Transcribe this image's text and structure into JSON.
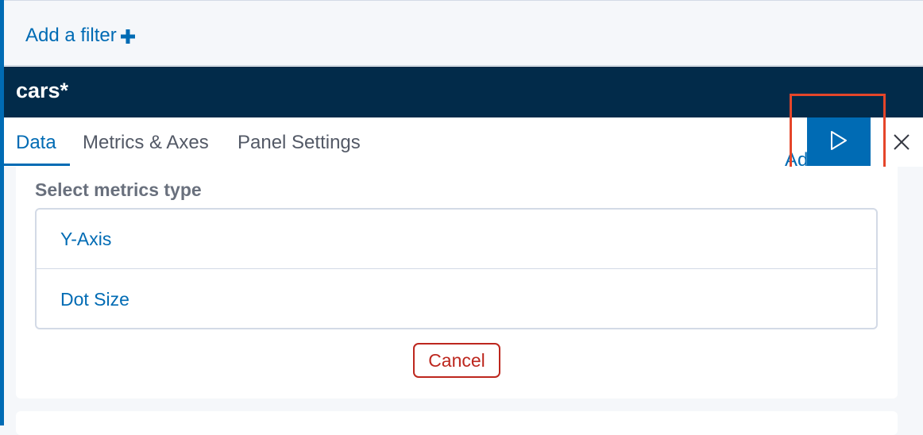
{
  "filter_bar": {
    "add_filter_label": "Add a filter"
  },
  "header": {
    "index_pattern": "cars*"
  },
  "tabs": [
    {
      "label": "Data",
      "active": true
    },
    {
      "label": "Metrics & Axes",
      "active": false
    },
    {
      "label": "Panel Settings",
      "active": false
    }
  ],
  "toolbar": {
    "advanced_label": "Advanced",
    "apply_icon": "play-icon",
    "close_icon": "close-icon"
  },
  "metrics_panel": {
    "label": "Select metrics type",
    "options": [
      "Y-Axis",
      "Dot Size"
    ],
    "cancel_label": "Cancel"
  },
  "colors": {
    "accent": "#006bb4",
    "header_bg": "#022b4a",
    "danger": "#bd271e",
    "highlight": "#e5462a"
  }
}
